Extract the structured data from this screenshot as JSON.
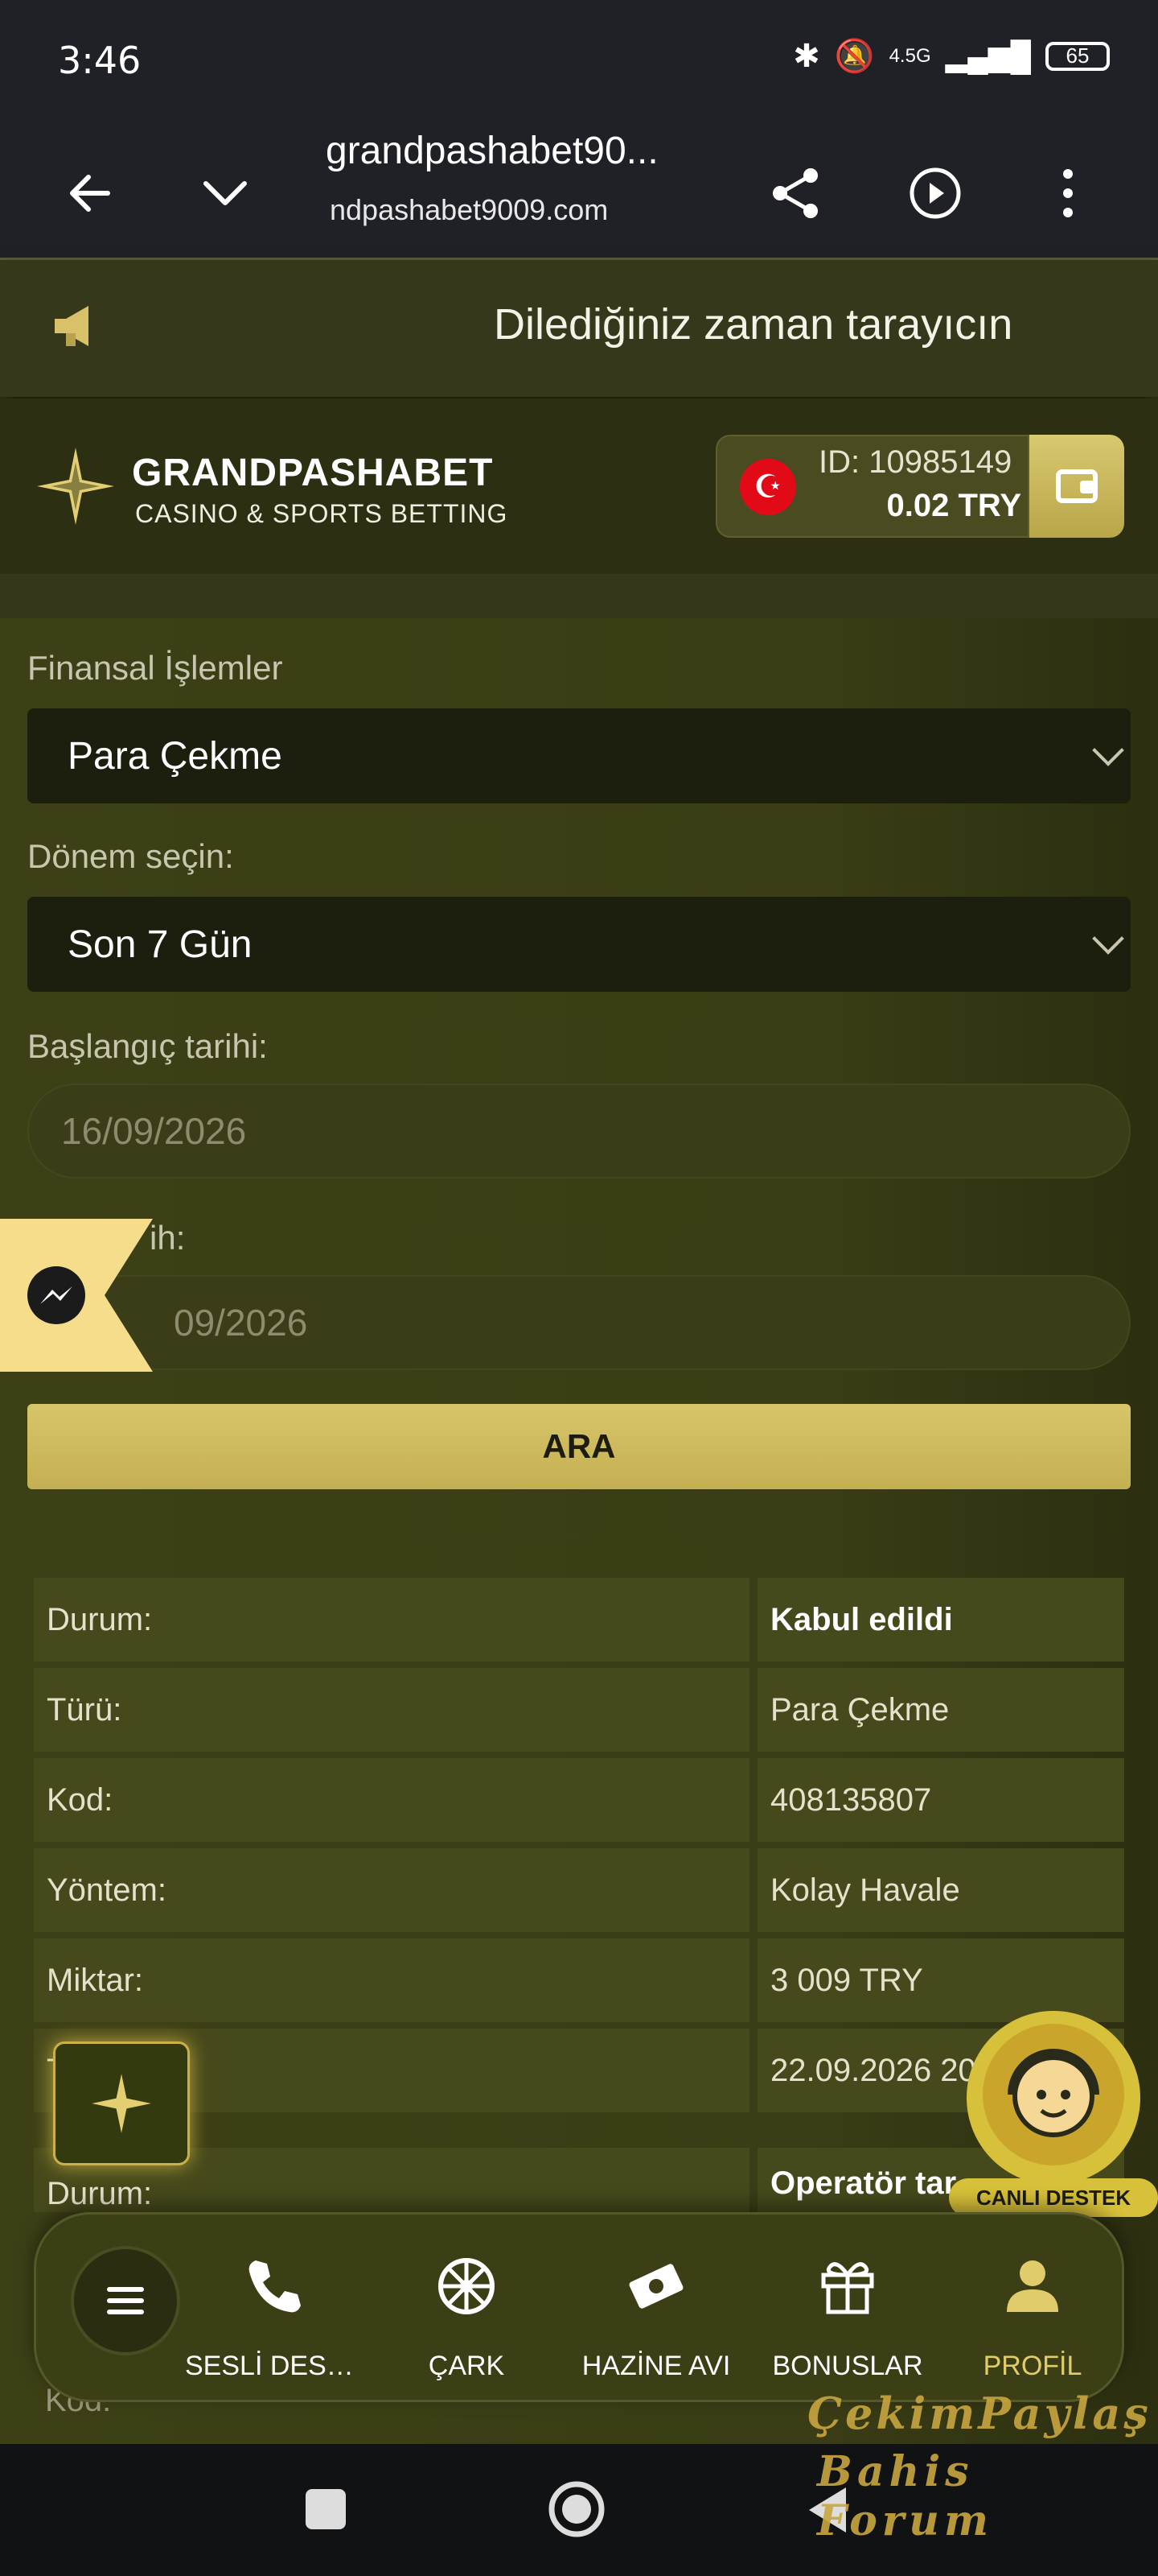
{
  "status_bar": {
    "time": "3:46",
    "network": "4.5G",
    "battery": "65"
  },
  "browser": {
    "title": "grandpashabet90...",
    "domain": "ndpashabet9009.com"
  },
  "marquee": {
    "text": "Dilediğiniz zaman tarayıcın"
  },
  "header": {
    "brand_name": "GRANDPASHABET",
    "brand_sub": "CASINO & SPORTS BETTING",
    "user_id": "ID: 10985149",
    "balance": "0.02 TRY"
  },
  "form": {
    "finance_label": "Finansal İşlemler",
    "finance_value": "Para Çekme",
    "period_label": "Dönem seçin:",
    "period_value": "Son 7 Gün",
    "start_label": "Başlangıç tarihi:",
    "start_value": "16/09/2026",
    "end_label": "ih:",
    "end_value": "09/2026",
    "search_label": "ARA"
  },
  "table": {
    "rows": [
      {
        "label": "Durum:",
        "value": "Kabul edildi"
      },
      {
        "label": "Türü:",
        "value": "Para Çekme"
      },
      {
        "label": "Kod:",
        "value": "408135807"
      },
      {
        "label": "Yöntem:",
        "value": "Kolay Havale"
      },
      {
        "label": "Miktar:",
        "value": "3 009 TRY"
      },
      {
        "label": "T",
        "value": "22.09.2026 20"
      }
    ],
    "second": {
      "label": "Durum:",
      "value": "Operatör tar"
    },
    "third_label": "Kod:"
  },
  "support_badge": "CANLI DESTEK",
  "bottom_nav": {
    "items": [
      {
        "label": "SESLİ DEST..."
      },
      {
        "label": "ÇARK"
      },
      {
        "label": "HAZİNE AVI"
      },
      {
        "label": "BONUSLAR"
      },
      {
        "label": "PROFİL"
      }
    ]
  },
  "watermark": {
    "line1": "ÇekimPaylaş",
    "line2": "Bahis Forum"
  },
  "colors": {
    "accent": "#d8c56a",
    "background": "#3a3c14",
    "cell": "#46491b"
  }
}
